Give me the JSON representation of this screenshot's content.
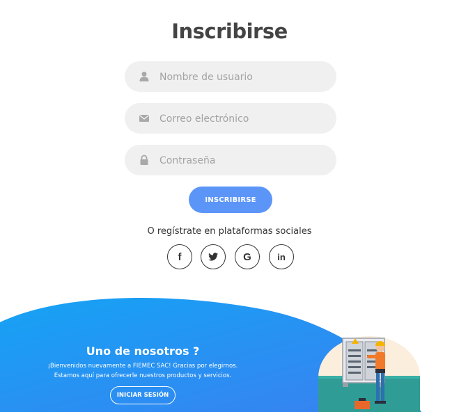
{
  "signup": {
    "title": "Inscribirse",
    "username_placeholder": "Nombre de usuario",
    "email_placeholder": "Correo electrónico",
    "password_placeholder": "Contraseña",
    "submit_label": "INSCRIBIRSE",
    "social_text": "O regístrate en plataformas sociales",
    "social": [
      {
        "icon": "facebook-icon",
        "glyph": "f"
      },
      {
        "icon": "twitter-icon",
        "glyph": ""
      },
      {
        "icon": "google-icon",
        "glyph": "G"
      },
      {
        "icon": "linkedin-icon",
        "glyph": "in"
      }
    ]
  },
  "panel": {
    "title": "Uno de nosotros ?",
    "desc_line1": "¡Bienvenidos nuevamente a FIEMEC SAC! Gracias por elegirnos.",
    "desc_line2": "Estamos aquí para ofrecerle nuestros productos y servicios.",
    "button_label": "INICIAR SESIÓN"
  },
  "colors": {
    "primary": "#5c95f8",
    "panel_gradient_start": "#15a3f5",
    "panel_gradient_end": "#3a80f0",
    "field_bg": "#f0f0f0",
    "title": "#444444"
  }
}
